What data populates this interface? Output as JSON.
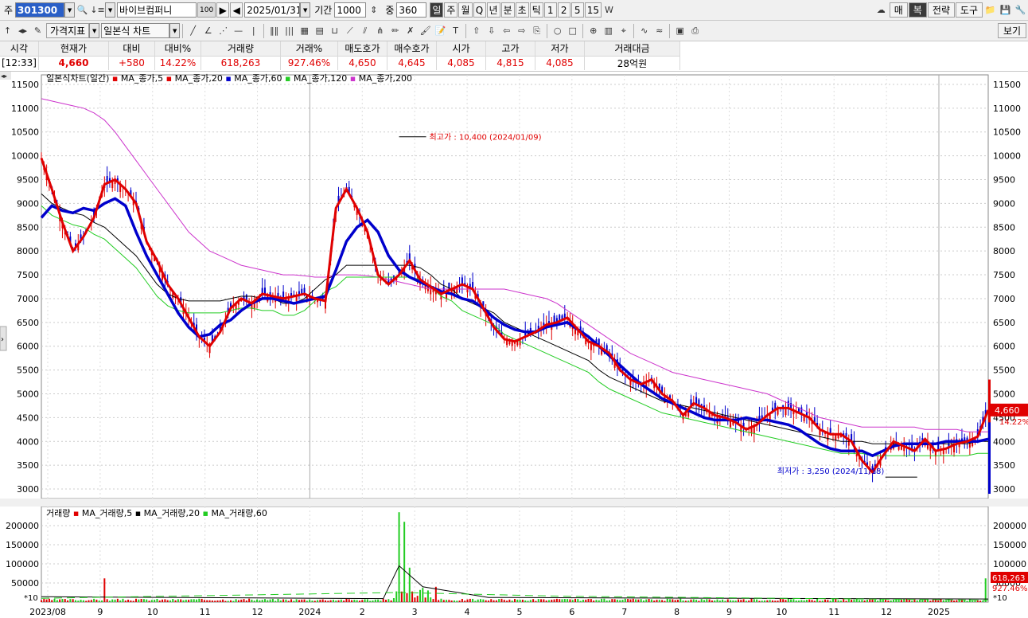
{
  "toolbar": {
    "code_label": "주",
    "stock_code": "301300",
    "stock_name": "바이브컴퍼니",
    "name_tag": "100",
    "date": "2025/01/31",
    "period_label": "기간",
    "period_value": "1000",
    "zoom_label": "중",
    "zoom_value": "360",
    "timeframes": [
      "일",
      "주",
      "월",
      "Q",
      "년",
      "분",
      "초",
      "틱",
      "1",
      "2",
      "5",
      "15"
    ],
    "active_timeframe": "일",
    "right_buttons": [
      "매",
      "복",
      "전략",
      "도구"
    ],
    "active_right": "복",
    "indicator_label": "가격지표",
    "chart_type": "일본식 차트",
    "view_button": "보기"
  },
  "quote": {
    "headers": [
      "시각",
      "현재가",
      "대비",
      "대비%",
      "거래량",
      "거래%",
      "매도호가",
      "매수호가",
      "시가",
      "고가",
      "저가",
      "거래대금"
    ],
    "values": [
      "[12:33]",
      "4,660",
      "+580",
      "14.22%",
      "618,263",
      "927.46%",
      "4,650",
      "4,645",
      "4,085",
      "4,815",
      "4,085",
      "28억원"
    ]
  },
  "chart_data": {
    "type": "line",
    "title": "일본식차트(일간)",
    "legend": [
      {
        "name": "MA_종가,5",
        "color": "#e00000"
      },
      {
        "name": "MA_종가,20",
        "color": "#e00000"
      },
      {
        "name": "MA_종가,60",
        "color": "#0000cc"
      },
      {
        "name": "MA_종가,120",
        "color": "#22cc22"
      },
      {
        "name": "MA_종가,200",
        "color": "#cc33cc"
      }
    ],
    "x_ticks": [
      "2023/08",
      "9",
      "10",
      "11",
      "12",
      "2024",
      "2",
      "3",
      "4",
      "5",
      "6",
      "7",
      "8",
      "9",
      "10",
      "11",
      "12",
      "2025"
    ],
    "ylim": [
      2800,
      11700
    ],
    "y_ticks": [
      3000,
      3500,
      4000,
      4500,
      5000,
      5500,
      6000,
      6500,
      7000,
      7500,
      8000,
      8500,
      9000,
      9500,
      10000,
      10500,
      11000,
      11500
    ],
    "high_annotation": "최고가 : 10,400 (2024/01/09)",
    "low_annotation": "최저가 : 3,250 (2024/11/18)",
    "last_price": "4,660",
    "last_pct": "14.22%",
    "price": {
      "x": [
        0,
        4,
        8,
        12,
        16,
        20,
        24,
        28,
        32,
        36,
        40,
        44,
        48,
        52,
        56,
        60,
        64,
        68,
        72,
        76,
        80,
        84,
        88,
        92,
        96,
        100,
        104,
        108,
        112,
        116,
        120,
        124,
        128,
        132,
        136,
        140,
        144,
        148,
        152,
        156,
        160,
        164,
        168,
        172,
        176,
        180,
        184,
        188,
        192,
        196,
        200,
        204,
        208,
        212,
        216,
        220,
        224,
        228,
        232,
        236,
        240,
        244,
        248,
        252,
        256,
        260,
        264,
        268,
        272,
        276,
        280,
        284,
        288,
        292,
        296,
        300,
        304,
        308,
        312,
        316,
        320,
        324,
        328,
        332,
        336,
        340,
        344,
        348,
        352,
        356,
        360
      ],
      "ma5": [
        9950,
        9300,
        8600,
        8000,
        8300,
        8700,
        9400,
        9500,
        9300,
        9000,
        8200,
        7800,
        7300,
        7000,
        6600,
        6200,
        6000,
        6300,
        6800,
        7000,
        6900,
        7100,
        7050,
        7000,
        7050,
        7100,
        7000,
        6950,
        8900,
        9300,
        8900,
        8400,
        7500,
        7300,
        7500,
        7800,
        7400,
        7250,
        7100,
        7200,
        7300,
        7200,
        6800,
        6400,
        6150,
        6100,
        6200,
        6300,
        6450,
        6500,
        6600,
        6350,
        6100,
        6000,
        5850,
        5500,
        5300,
        5200,
        5300,
        5000,
        4850,
        4550,
        4800,
        4700,
        4550,
        4500,
        4400,
        4250,
        4350,
        4550,
        4700,
        4700,
        4600,
        4500,
        4250,
        4150,
        4150,
        4000,
        3600,
        3350,
        3700,
        4000,
        3900,
        3800,
        4050,
        3800,
        3850,
        3950,
        4000,
        4100,
        4660
      ],
      "ma60": [
        8700,
        8950,
        8850,
        8800,
        8900,
        8850,
        9000,
        9100,
        8950,
        8400,
        7900,
        7500,
        7100,
        6700,
        6400,
        6200,
        6250,
        6450,
        6550,
        6750,
        6900,
        7000,
        7000,
        6950,
        6900,
        6950,
        7000,
        7050,
        7600,
        8200,
        8500,
        8650,
        8400,
        7900,
        7600,
        7450,
        7350,
        7250,
        7150,
        7100,
        7000,
        6950,
        6800,
        6600,
        6450,
        6350,
        6300,
        6300,
        6400,
        6450,
        6500,
        6350,
        6200,
        6000,
        5800,
        5600,
        5400,
        5200,
        5050,
        4900,
        4800,
        4700,
        4600,
        4500,
        4450,
        4450,
        4450,
        4500,
        4450,
        4450,
        4400,
        4350,
        4250,
        4100,
        3950,
        3850,
        3800,
        3800,
        3800,
        3700,
        3800,
        3900,
        3950,
        3950,
        3950,
        3950,
        4000,
        4000,
        4000,
        4000,
        4050
      ],
      "ma120": [
        9200,
        9000,
        8900,
        8800,
        8750,
        8600,
        8500,
        8300,
        8100,
        7900,
        7600,
        7300,
        7100,
        7000,
        6950,
        6950,
        6950,
        6950,
        7000,
        7050,
        7050,
        7000,
        7000,
        6900,
        6900,
        7000,
        7200,
        7400,
        7500,
        7700,
        7700,
        7700,
        7700,
        7700,
        7700,
        7700,
        7650,
        7500,
        7300,
        7200,
        7000,
        6900,
        6800,
        6700,
        6500,
        6400,
        6300,
        6200,
        6100,
        6000,
        5900,
        5800,
        5700,
        5500,
        5350,
        5250,
        5150,
        5050,
        4950,
        4850,
        4800,
        4750,
        4700,
        4650,
        4600,
        4550,
        4500,
        4450,
        4400,
        4350,
        4300,
        4250,
        4200,
        4150,
        4100,
        4050,
        4000,
        4000,
        4000,
        3950,
        3950,
        3950,
        3950,
        3950,
        3950,
        3950,
        3950,
        3950,
        3950,
        4000,
        4000
      ],
      "ma200": [
        11200,
        11150,
        11100,
        11050,
        11000,
        10900,
        10750,
        10500,
        10200,
        9900,
        9600,
        9300,
        9000,
        8700,
        8400,
        8200,
        8000,
        7900,
        7800,
        7700,
        7650,
        7600,
        7550,
        7500,
        7500,
        7480,
        7450,
        7450,
        7500,
        7500,
        7500,
        7480,
        7450,
        7400,
        7350,
        7300,
        7250,
        7200,
        7200,
        7200,
        7200,
        7200,
        7200,
        7200,
        7200,
        7150,
        7100,
        7050,
        7000,
        6900,
        6750,
        6600,
        6450,
        6300,
        6150,
        6000,
        5850,
        5750,
        5650,
        5550,
        5450,
        5400,
        5350,
        5300,
        5250,
        5200,
        5150,
        5100,
        5050,
        5000,
        4900,
        4800,
        4700,
        4600,
        4500,
        4450,
        4400,
        4350,
        4300,
        4300,
        4300,
        4300,
        4300,
        4300,
        4250,
        4250,
        4250,
        4250,
        4200,
        4200,
        4200
      ]
    },
    "volume": {
      "title": "거래량",
      "legend": [
        {
          "name": "MA_거래량,5",
          "color": "#e00000"
        },
        {
          "name": "MA_거래량,20",
          "color": "#000000"
        },
        {
          "name": "MA_거래량,60",
          "color": "#22cc22"
        }
      ],
      "ylim": [
        0,
        250000
      ],
      "y_ticks": [
        50000,
        100000,
        150000,
        200000
      ],
      "scale_label": "*10",
      "last_volume": "618,263",
      "last_pct": "927.46%",
      "spikes": [
        {
          "x": 24,
          "v": 62000
        },
        {
          "x": 136,
          "v": 235000
        },
        {
          "x": 138,
          "v": 210000
        },
        {
          "x": 140,
          "v": 90000
        },
        {
          "x": 150,
          "v": 40000
        },
        {
          "x": 359,
          "v": 62000
        }
      ]
    }
  }
}
